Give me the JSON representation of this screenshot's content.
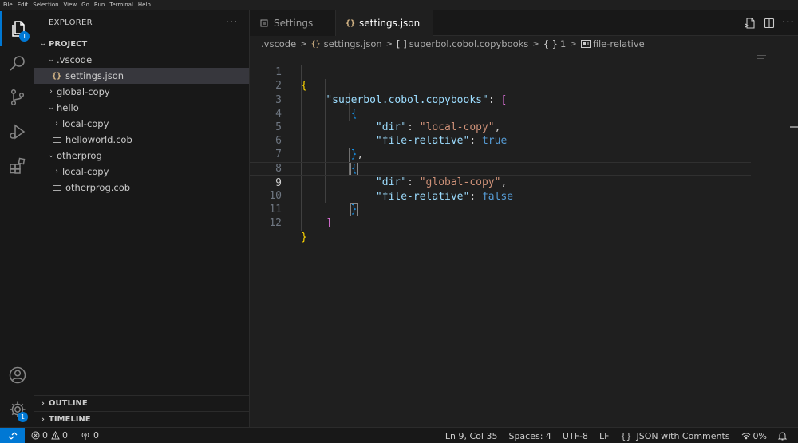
{
  "menu": [
    "File",
    "Edit",
    "Selection",
    "View",
    "Go",
    "Run",
    "Terminal",
    "Help"
  ],
  "activity": {
    "explorer_badge": "1",
    "settings_badge": "1"
  },
  "sidebar": {
    "title": "EXPLORER",
    "more": "···",
    "project_label": "PROJECT",
    "tree": [
      {
        "label": ".vscode",
        "kind": "folder-open",
        "depth": 1
      },
      {
        "label": "settings.json",
        "kind": "json",
        "depth": 2,
        "selected": true
      },
      {
        "label": "global-copy",
        "kind": "folder-closed",
        "depth": 1
      },
      {
        "label": "hello",
        "kind": "folder-open",
        "depth": 1
      },
      {
        "label": "local-copy",
        "kind": "folder-closed",
        "depth": 2
      },
      {
        "label": "helloworld.cob",
        "kind": "file",
        "depth": 2
      },
      {
        "label": "otherprog",
        "kind": "folder-open",
        "depth": 1
      },
      {
        "label": "local-copy",
        "kind": "folder-closed",
        "depth": 2
      },
      {
        "label": "otherprog.cob",
        "kind": "file",
        "depth": 2
      }
    ],
    "outline_label": "OUTLINE",
    "timeline_label": "TIMELINE"
  },
  "tabs": [
    {
      "label": "Settings",
      "active": false
    },
    {
      "label": "settings.json",
      "active": true,
      "modified": true
    }
  ],
  "breadcrumb": {
    "folder": ".vscode",
    "file_icon": "{}",
    "file": "settings.json",
    "array_icon": "[ ]",
    "array": "superbol.cobol.copybooks",
    "obj_icon": "{ }",
    "index": "1",
    "prop": "file-relative"
  },
  "code": {
    "line_numbers": [
      "1",
      "2",
      "3",
      "4",
      "5",
      "6",
      "7",
      "8",
      "9",
      "10",
      "11",
      "12"
    ],
    "current_line": 9,
    "key_copybooks": "\"superbol.cobol.copybooks\"",
    "key_dir": "\"dir\"",
    "key_rel": "\"file-relative\"",
    "val_local": "\"local-copy\"",
    "val_global": "\"global-copy\"",
    "val_true": "true",
    "val_false": "false"
  },
  "status": {
    "errors": "0",
    "warnings": "0",
    "ports": "0",
    "position": "Ln 9, Col 35",
    "spaces": "Spaces: 4",
    "encoding": "UTF-8",
    "eol": "LF",
    "lang_icon": "{}",
    "language": "JSON with Comments",
    "zoom": "0%"
  },
  "colors": {
    "accent": "#0078d4",
    "key": "#9cdcfe",
    "string": "#ce9178",
    "boolean": "#569cd6"
  }
}
